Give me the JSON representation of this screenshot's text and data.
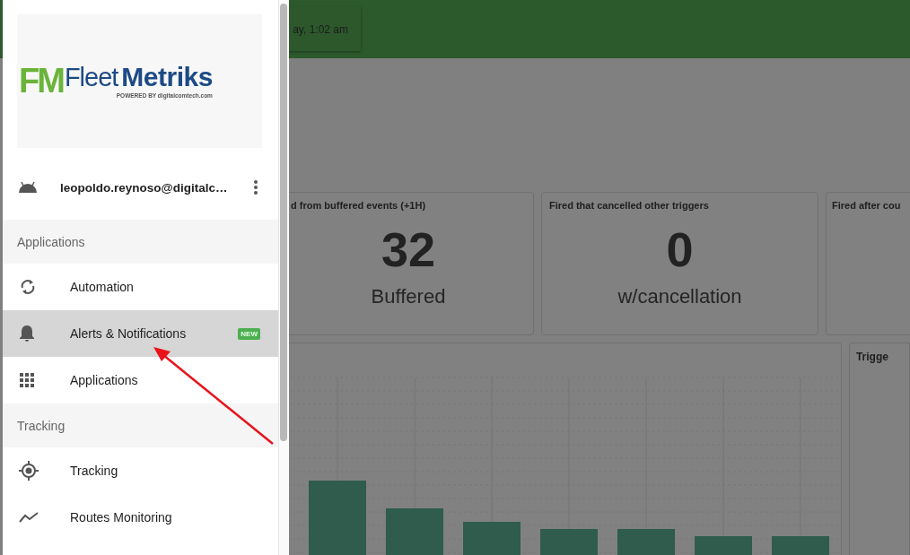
{
  "header": {
    "date_text": "ay, 1:02 am"
  },
  "stat_cards": [
    {
      "title": "d from buffered events (+1H)",
      "value": "32",
      "caption": "Buffered"
    },
    {
      "title": "Fired that cancelled other triggers",
      "value": "0",
      "caption": "w/cancellation"
    },
    {
      "title": "Fired after cou"
    }
  ],
  "side_panel": {
    "title": "Trigge"
  },
  "drawer": {
    "logo": {
      "monogram": "FM",
      "name_light": "Fleet",
      "name_bold": "Metriks",
      "tagline": "POWERED BY digitalcomtech.com"
    },
    "user": {
      "email": "leopoldo.reynoso@digitalc…"
    },
    "sections": [
      {
        "title": "Applications",
        "items": [
          {
            "label": "Automation",
            "kind": "sync",
            "selected": false
          },
          {
            "label": "Alerts & Notifications",
            "kind": "bell",
            "selected": true,
            "badge": "NEW"
          },
          {
            "label": "Applications",
            "kind": "apps",
            "selected": false
          }
        ]
      },
      {
        "title": "Tracking",
        "items": [
          {
            "label": "Tracking",
            "kind": "target",
            "selected": false
          },
          {
            "label": "Routes Monitoring",
            "kind": "trend",
            "selected": false
          }
        ]
      }
    ]
  }
}
